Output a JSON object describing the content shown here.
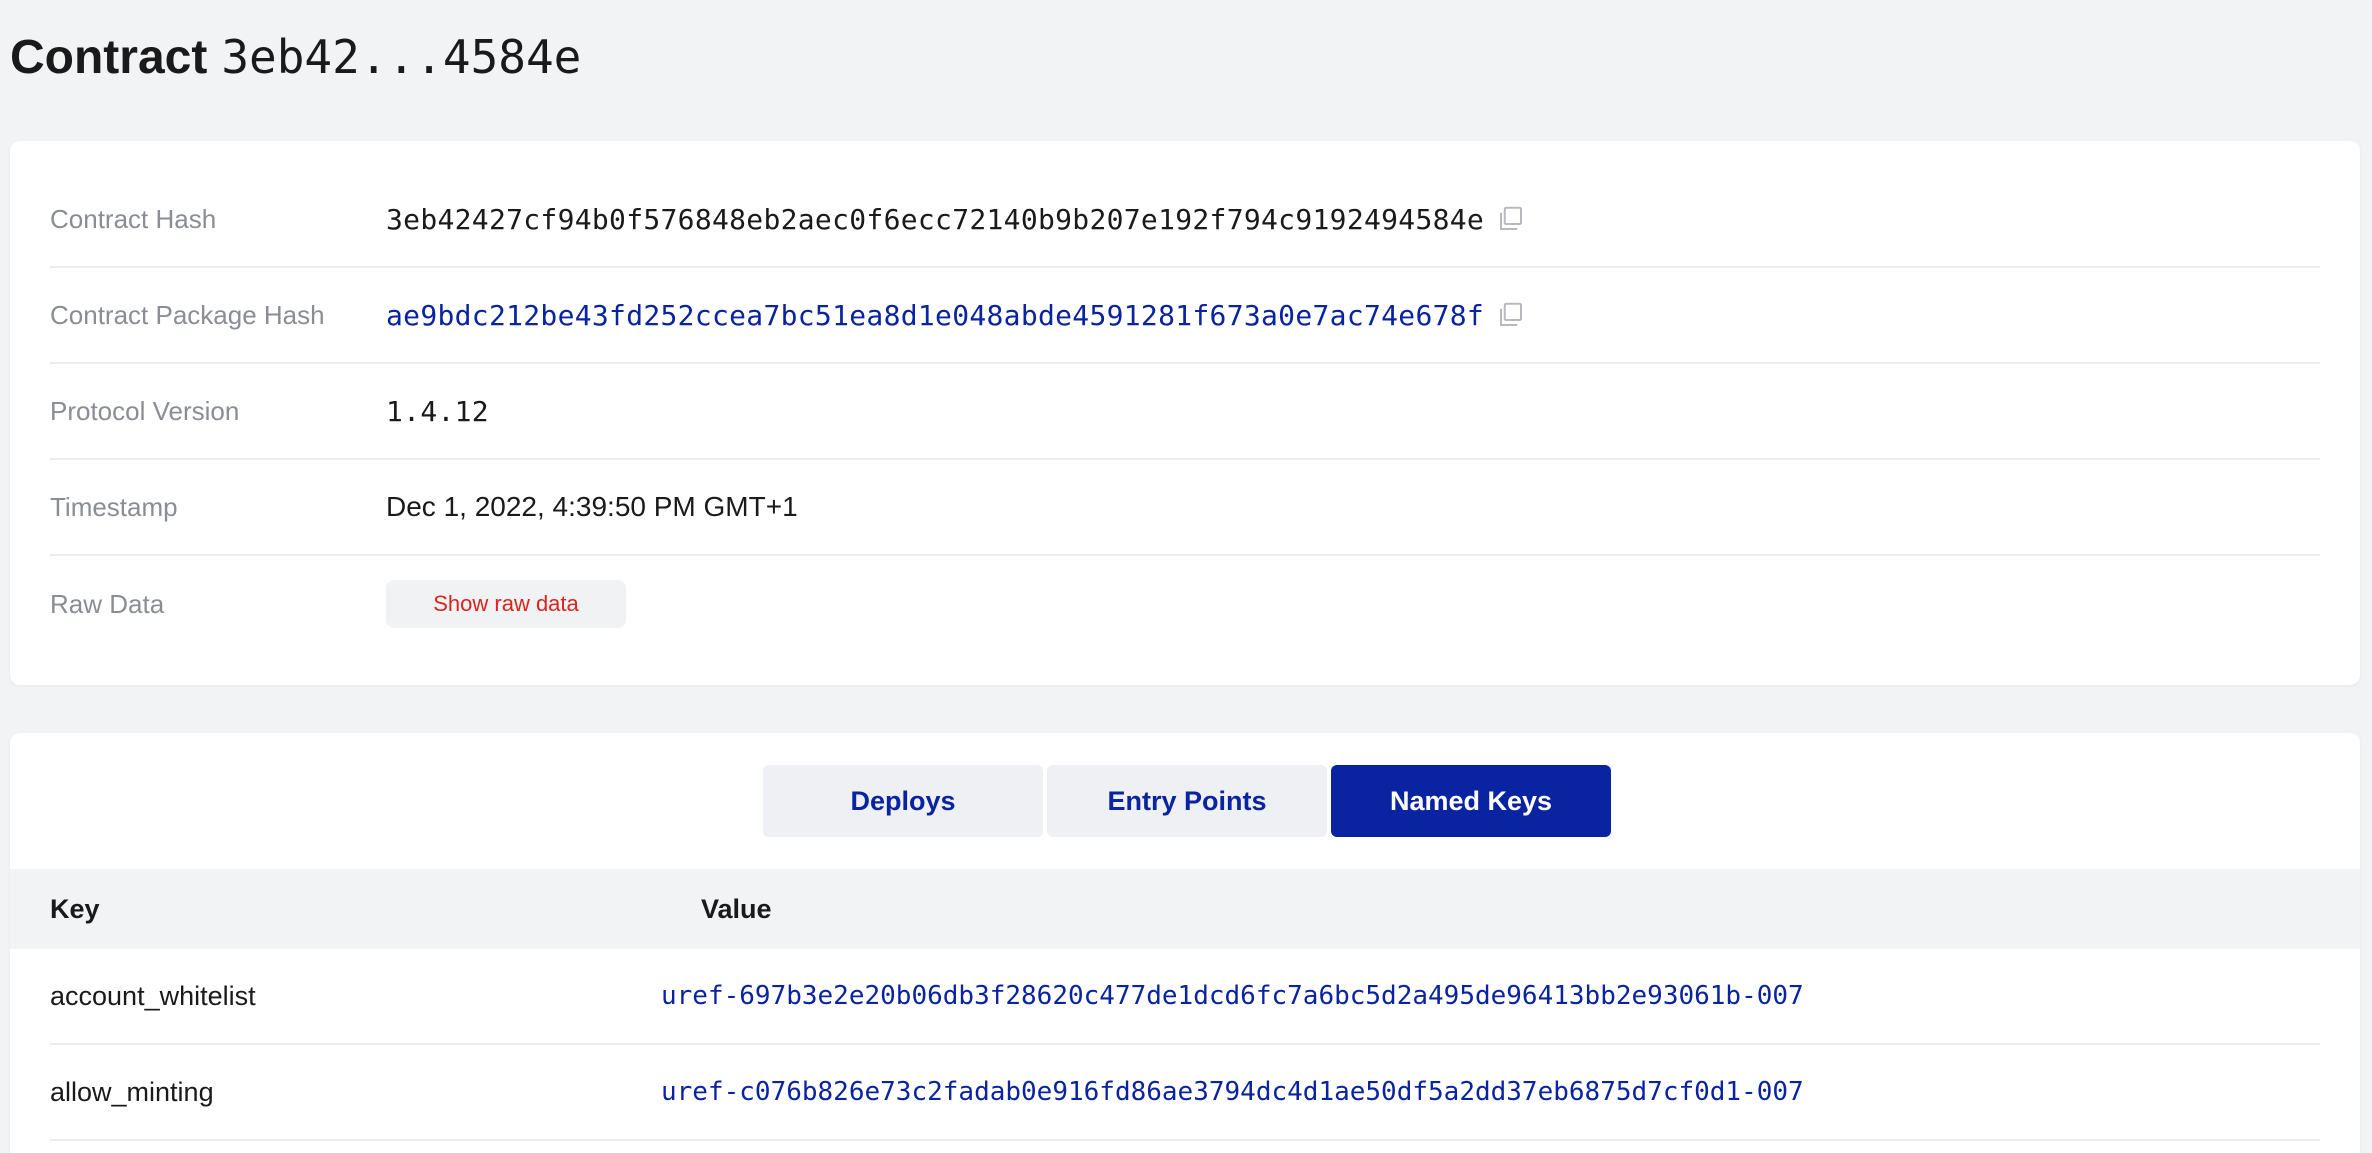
{
  "header": {
    "title_word": "Contract",
    "title_hash": "3eb42...4584e"
  },
  "details": {
    "contract_hash_label": "Contract Hash",
    "contract_hash": "3eb42427cf94b0f576848eb2aec0f6ecc72140b9b207e192f794c9192494584e",
    "package_hash_label": "Contract Package Hash",
    "package_hash": "ae9bdc212be43fd252ccea7bc51ea8d1e048abde4591281f673a0e7ac74e678f",
    "protocol_label": "Protocol Version",
    "protocol": "1.4.12",
    "timestamp_label": "Timestamp",
    "timestamp": "Dec 1, 2022, 4:39:50 PM GMT+1",
    "raw_label": "Raw Data",
    "raw_button": "Show raw data"
  },
  "tabs": {
    "deploys": "Deploys",
    "entry_points": "Entry Points",
    "named_keys": "Named Keys",
    "active": "named_keys"
  },
  "table": {
    "col_key": "Key",
    "col_value": "Value",
    "rows": [
      {
        "key": "account_whitelist",
        "value": "uref-697b3e2e20b06db3f28620c477de1dcd6fc7a6bc5d2a495de96413bb2e93061b-007"
      },
      {
        "key": "allow_minting",
        "value": "uref-c076b826e73c2fadab0e916fd86ae3794dc4d1ae50df5a2dd37eb6875d7cf0d1-007"
      }
    ]
  },
  "colors": {
    "accent": "#0a23a0",
    "danger": "#d8261b",
    "background": "#f2f3f5"
  }
}
